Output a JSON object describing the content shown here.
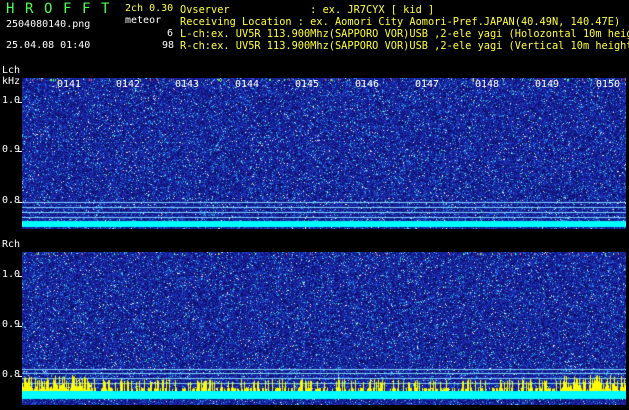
{
  "header": {
    "title_letters": [
      "H",
      "R",
      "O",
      "F",
      "F",
      "T"
    ],
    "version": "2ch 0.30",
    "filename": "2504080140.png",
    "meteor_label": "meteor",
    "lch_count": "6",
    "rch_count": "98",
    "datetime": "25.04.08 01:40",
    "observer": "Ovserver             : ex. JR7CYX [ kid ]",
    "location": "Receiving Location : ex. Aomori City Aomori-Pref.JAPAN(40.49N, 140.47E)",
    "lch_info": "L-ch:ex. UV5R 113.900Mhz(SAPPORO VOR)USB ,2-ele yagi (Holozontal 10m height)",
    "rch_info": "R-ch:ex. UV5R 113.900Mhz(SAPPORO VOR)USB ,2-ele yagi (Vertical 10m height)"
  },
  "lch": {
    "label": "Lch",
    "unit": "kHz",
    "ticks": [
      "1.0",
      "0.9",
      "0.8"
    ],
    "time_labels": [
      "0141",
      "0142",
      "0143",
      "0144",
      "0145",
      "0146",
      "0147",
      "0148",
      "0149",
      "0150"
    ]
  },
  "rch": {
    "label": "Rch",
    "ticks": [
      "1.0",
      "0.9",
      "0.8"
    ]
  },
  "colors": {
    "title_green": "#4cff4c",
    "version_yellow": "#ffff40",
    "noise_floor": "#1a1a9a",
    "baseline_cyan": "#00ffff",
    "meteor_yellow": "#ffff00"
  }
}
